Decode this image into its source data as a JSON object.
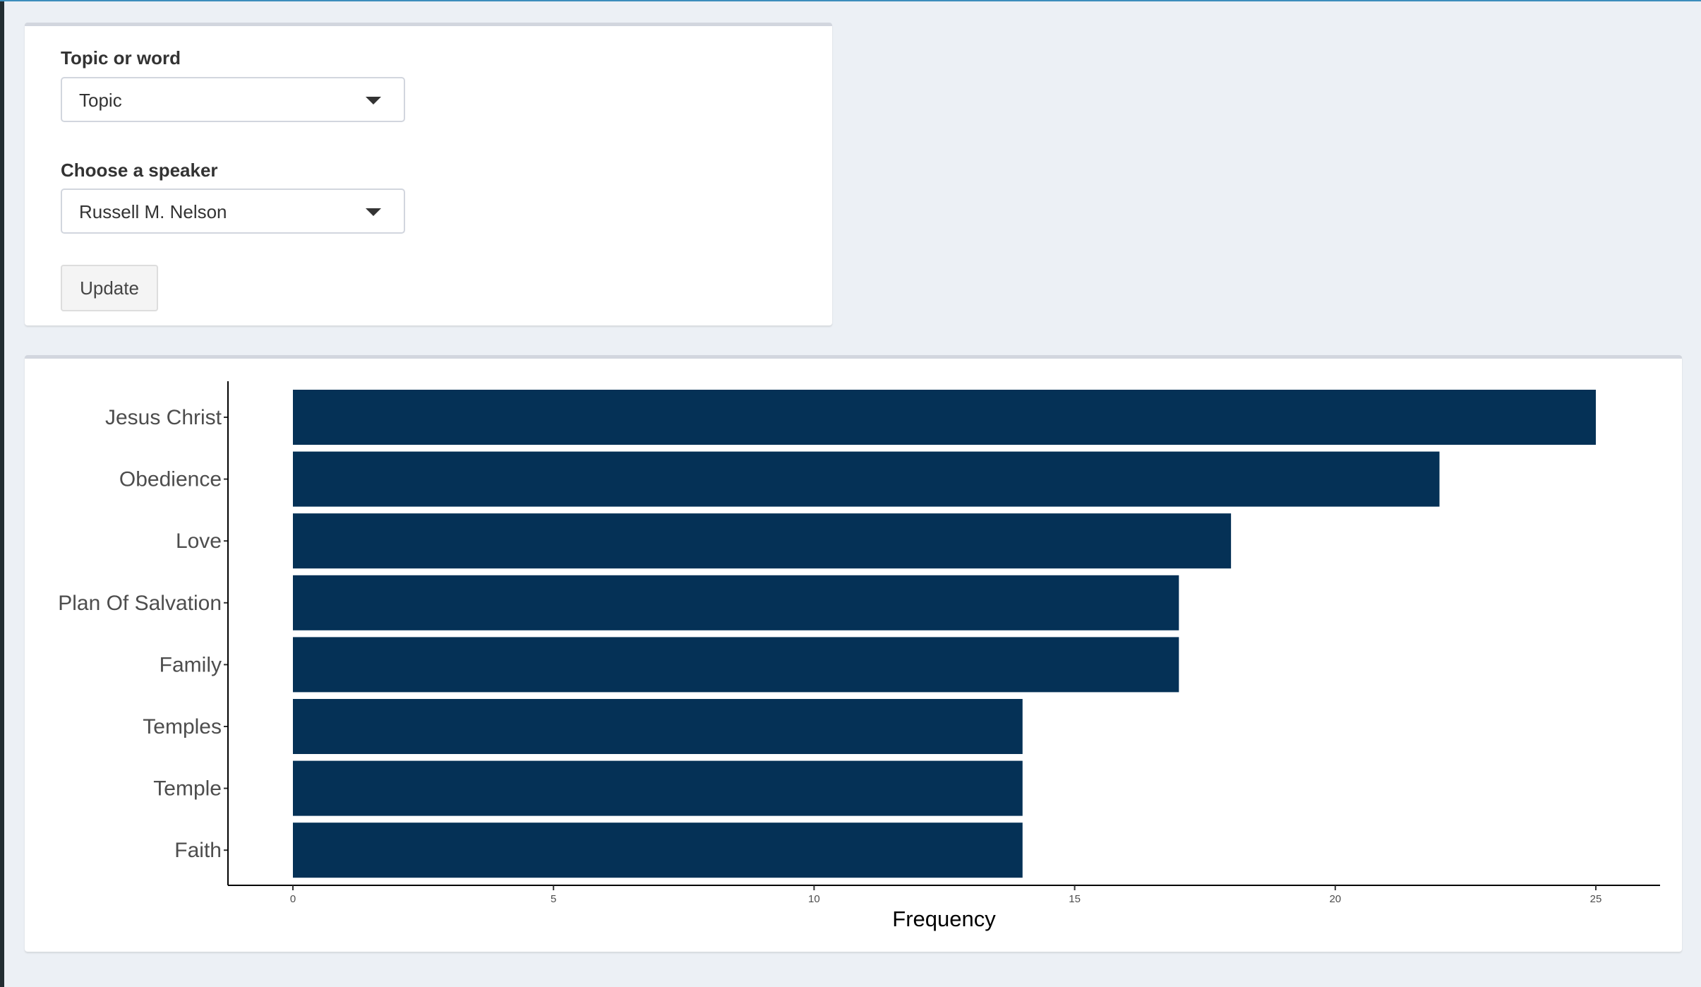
{
  "controls": {
    "topic_label": "Topic or word",
    "topic_value": "Topic",
    "speaker_label": "Choose a speaker",
    "speaker_value": "Russell M. Nelson",
    "update_label": "Update"
  },
  "colors": {
    "bar": "#053156",
    "accent": "#3c8dbc"
  },
  "chart_data": {
    "type": "bar",
    "orientation": "horizontal",
    "categories": [
      "Jesus Christ",
      "Obedience",
      "Love",
      "Plan Of Salvation",
      "Family",
      "Temples",
      "Temple",
      "Faith"
    ],
    "values": [
      25,
      22,
      18,
      17,
      17,
      14,
      14,
      14
    ],
    "title": "",
    "xlabel": "Frequency",
    "ylabel": "",
    "xlim": [
      -1.25,
      26.25
    ],
    "xticks": [
      0,
      5,
      10,
      15,
      20,
      25
    ],
    "grid": false
  }
}
